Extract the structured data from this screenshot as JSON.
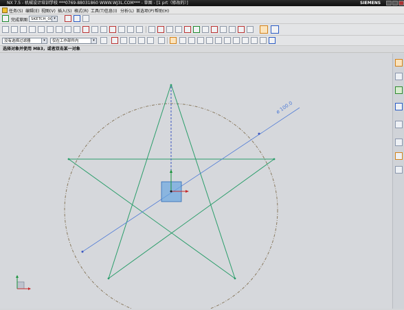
{
  "window": {
    "title": "NX 7.5 - 机械设计培训学校   ***0769-88031860   WWW.WJ3L.COM***   - 草图 - [1 prt（修改的）]",
    "brand": "SIEMENS"
  },
  "menubar": {
    "items": [
      "任务(S)",
      "编辑(E)",
      "视图(V)",
      "插入(S)",
      "格式(R)",
      "工具(T)",
      "信息(I)",
      "分析(L)",
      "首选项(P)",
      "帮助(H)"
    ]
  },
  "sketch_toolbar": {
    "finish_label": "完成草图",
    "sketch_name": "SKETCH_000"
  },
  "selection_bar": {
    "filter": "没有选择过滤器",
    "scope": "仅在工作部件内"
  },
  "status_bar": {
    "message": "选择对象并使用 MB3，或者双击某一对象"
  },
  "sketch": {
    "dimension_label": "ø 100.0",
    "line_color": "#2a9d6a",
    "circle_color": "#8a7a5f",
    "dimension_color": "#4f7bd6"
  },
  "icons": {
    "right_toolbar": [
      "rollback-icon",
      "part-navigator-icon",
      "assembly-icon",
      "history-icon",
      "roles-icon",
      "clock-icon",
      "web-browser-icon",
      "palette-icon"
    ]
  }
}
